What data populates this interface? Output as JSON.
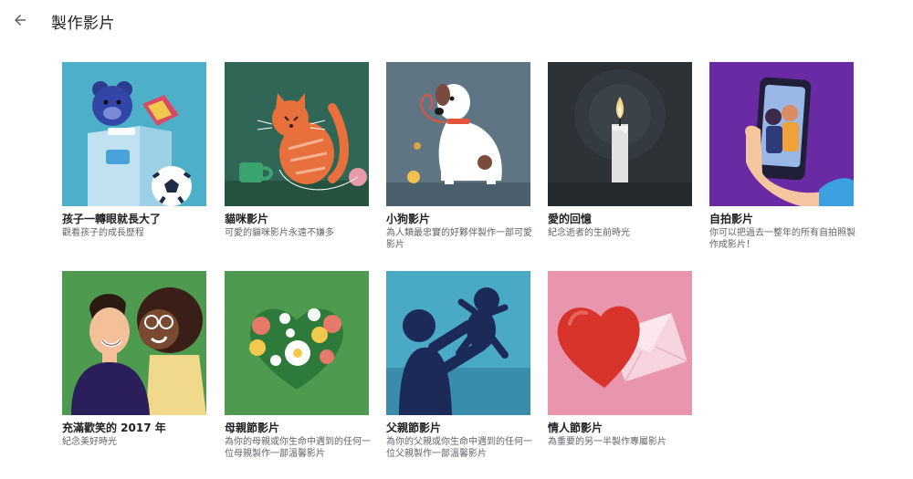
{
  "header": {
    "back_icon": "arrow-back-icon",
    "title": "製作影片"
  },
  "cards": [
    {
      "title": "孩子一轉眼就長大了",
      "description": "觀看孩子的成長歷程",
      "thumb_bg": "#4db0c8",
      "icon": "teddy-bear-toybox-illustration"
    },
    {
      "title": "貓咪影片",
      "description": "可愛的貓咪影片永遠不嫌多",
      "thumb_bg": "#2f6655",
      "icon": "cat-with-yarn-illustration"
    },
    {
      "title": "小狗影片",
      "description": "為人類最忠實的好夥伴製作一部可愛影片",
      "thumb_bg": "#5f7584",
      "icon": "dog-with-leash-illustration"
    },
    {
      "title": "愛的回憶",
      "description": "紀念逝者的生前時光",
      "thumb_bg": "#2c3236",
      "icon": "candle-illustration"
    },
    {
      "title": "自拍影片",
      "description": "你可以把過去一整年的所有自拍照製作成影片！",
      "thumb_bg": "#6a2aa3",
      "icon": "selfie-phone-illustration"
    },
    {
      "title": "充滿歡笑的 2017 年",
      "description": "紀念美好時光",
      "thumb_bg": "#4e9a4f",
      "icon": "smiling-couple-illustration"
    },
    {
      "title": "母親節影片",
      "description": "為你的母親或你生命中遇到的任何一位母親製作一部溫馨影片",
      "thumb_bg": "#4e9a4f",
      "icon": "flower-heart-illustration"
    },
    {
      "title": "父親節影片",
      "description": "為你的父親或你生命中遇到的任何一位父親製作一部溫馨影片",
      "thumb_bg": "#4aa9c4",
      "icon": "father-lifting-baby-illustration"
    },
    {
      "title": "情人節影片",
      "description": "為重要的另一半製作專屬影片",
      "thumb_bg": "#e895ad",
      "icon": "heart-and-envelope-illustration"
    }
  ]
}
